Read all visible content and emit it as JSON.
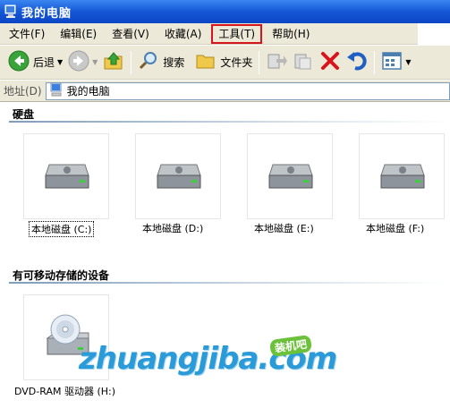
{
  "window": {
    "title": "我的电脑"
  },
  "menubar": {
    "items": [
      {
        "label": "文件(F)"
      },
      {
        "label": "编辑(E)"
      },
      {
        "label": "查看(V)"
      },
      {
        "label": "收藏(A)"
      },
      {
        "label": "工具(T)"
      },
      {
        "label": "帮助(H)"
      }
    ]
  },
  "toolbar": {
    "back_label": "后退",
    "search_label": "搜索",
    "folders_label": "文件夹"
  },
  "addressbar": {
    "label": "地址(D)",
    "value": "我的电脑"
  },
  "groups": {
    "hard_drives": {
      "header": "硬盘",
      "drives": [
        {
          "label": "本地磁盘 (C:)"
        },
        {
          "label": "本地磁盘 (D:)"
        },
        {
          "label": "本地磁盘 (E:)"
        },
        {
          "label": "本地磁盘 (F:)"
        }
      ]
    },
    "removable": {
      "header": "有可移动存储的设备",
      "devices": [
        {
          "label": "DVD-RAM 驱动器 (H:)"
        }
      ]
    }
  },
  "watermark": {
    "text": "zhuangjiba.com",
    "badge": "装机吧"
  },
  "colors": {
    "highlight_box": "#d8141c",
    "titlebar": "#1557d6",
    "watermark": "#2a9bd8"
  }
}
